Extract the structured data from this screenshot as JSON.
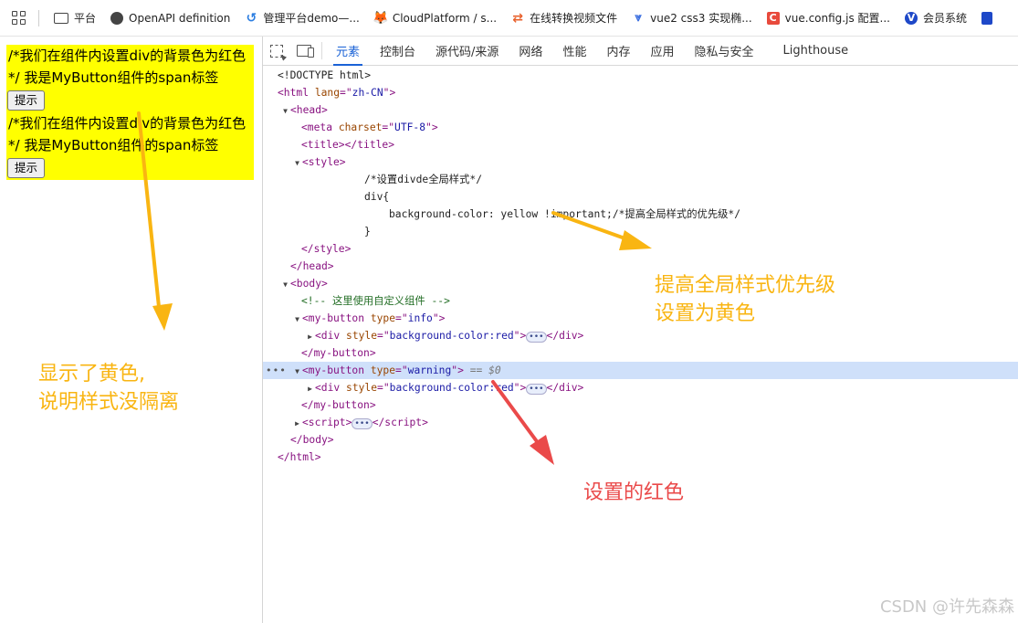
{
  "bookmarks": [
    {
      "label": "平台",
      "icon": "folder-icon"
    },
    {
      "label": "OpenAPI definition",
      "icon": "globe-icon"
    },
    {
      "label": "管理平台demo—...",
      "icon": "azure-icon"
    },
    {
      "label": "CloudPlatform / s...",
      "icon": "gitlab-icon"
    },
    {
      "label": "在线转换视频文件",
      "icon": "convert-icon"
    },
    {
      "label": "vue2 css3 实现椭...",
      "icon": "vue-icon"
    },
    {
      "label": "vue.config.js 配置...",
      "icon": "csdn-icon"
    },
    {
      "label": "会员系统",
      "icon": "member-icon"
    }
  ],
  "bookmark_glyphs": {
    "csdn": "C",
    "member": "V",
    "azure": "↺",
    "gitlab": "🦊",
    "swap": "⇄",
    "vue": "⩔"
  },
  "page": {
    "block_text": "/*我们在组件内设置div的背景色为红色*/ 我是MyButton组件的span标签",
    "button_label": "提示"
  },
  "devtools": {
    "tabs": [
      "元素",
      "控制台",
      "源代码/来源",
      "网络",
      "性能",
      "内存",
      "应用",
      "隐私与安全",
      "Lighthouse"
    ],
    "active_tab": "元素"
  },
  "dom": {
    "doctype": "<!DOCTYPE html>",
    "html_lang": "zh-CN",
    "meta_charset": "UTF-8",
    "css_comment": "/*设置divde全局样式*/",
    "css_selector": "div{",
    "css_decl": "background-color: yellow !important;/*提高全局样式的优先级*/",
    "css_close": "}",
    "body_comment": "<!-- 这里使用自定义组件 -->",
    "btn1_type": "info",
    "btn2_type": "warning",
    "div_style": "background-color:red",
    "selected_marker": "== $0",
    "dots": "•••"
  },
  "annotations": {
    "global_style": [
      "提高全局样式优先级",
      "设置为黄色"
    ],
    "shown_yellow": [
      "显示了黄色,",
      "说明样式没隔离"
    ],
    "set_red": "设置的红色",
    "watermark": "CSDN @许先森森"
  },
  "colors": {
    "yellow_annotation": "#f9b512",
    "red_annotation": "#ea4a4a",
    "page_block": "#ffff00",
    "active_tab": "#1a62d6"
  }
}
